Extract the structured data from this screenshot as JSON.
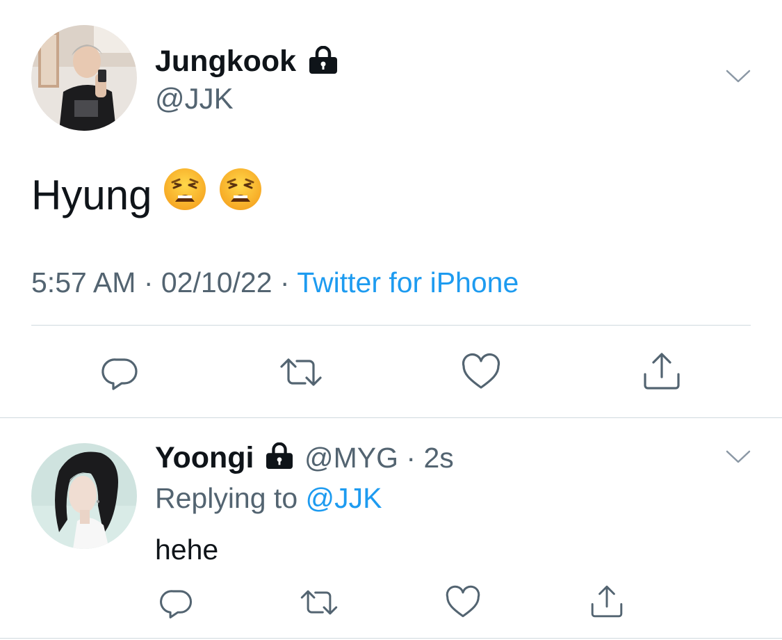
{
  "main_tweet": {
    "display_name": "Jungkook",
    "handle": "@JJK",
    "text": "Hyung",
    "emojis": [
      "weary-face",
      "weary-face"
    ],
    "time": "5:57 AM",
    "separator": "·",
    "date": "02/10/22",
    "source": "Twitter for iPhone",
    "protected_icon": "lock-icon",
    "menu_icon": "chevron-down-icon"
  },
  "main_actions": [
    "reply-icon",
    "retweet-icon",
    "like-icon",
    "share-icon"
  ],
  "reply_tweet": {
    "display_name": "Yoongi",
    "handle": "@MYG",
    "separator": "·",
    "age": "2s",
    "replying_prefix": "Replying to",
    "replying_to": "@JJK",
    "text": "hehe",
    "protected_icon": "lock-icon",
    "menu_icon": "chevron-down-icon"
  },
  "reply_actions": [
    "reply-icon",
    "retweet-icon",
    "like-icon",
    "share-icon"
  ],
  "colors": {
    "text_primary": "#0f1419",
    "text_secondary": "#536471",
    "link": "#1d9bf0",
    "divider": "#cfd9de",
    "icon": "#536471"
  }
}
